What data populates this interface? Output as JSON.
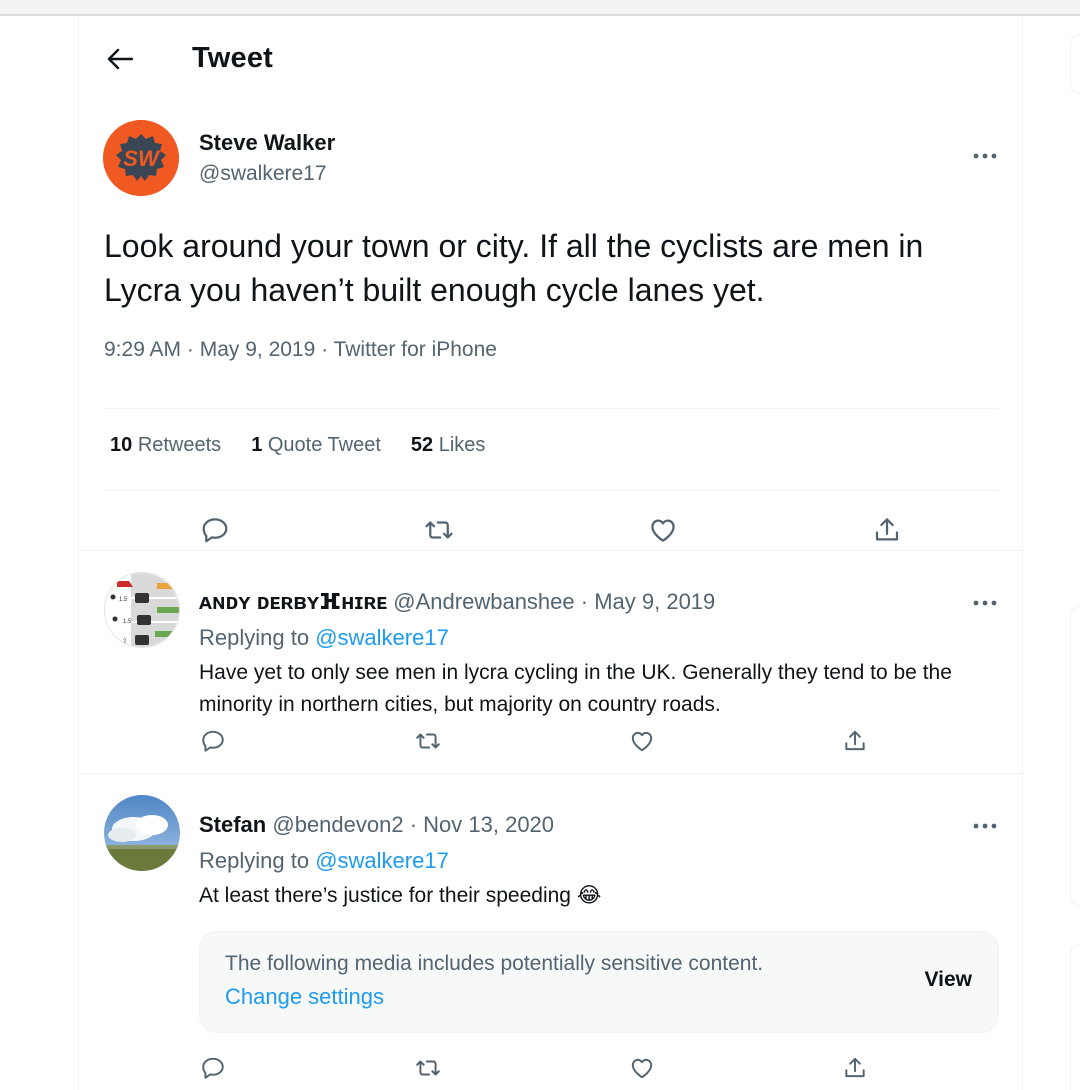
{
  "header": {
    "title": "Tweet"
  },
  "tweet": {
    "author_name": "Steve Walker",
    "author_handle": "@swalkere17",
    "avatar_text": "SW",
    "text": "Look around your town or city. If all the cyclists are men in Lycra you haven’t built enough cycle lanes yet.",
    "meta": "9:29 AM · May 9, 2019 · Twitter for iPhone",
    "stats": {
      "retweets_count": "10",
      "retweets_label": "Retweets",
      "quotes_count": "1",
      "quotes_label": "Quote Tweet",
      "likes_count": "52",
      "likes_label": "Likes"
    }
  },
  "replies": [
    {
      "name": "ᴀɴᴅʏ ᴅᴇʀʙʏⴼʜɪʀᴇ",
      "handle": "@Andrewbanshee",
      "date": "· May 9, 2019",
      "replying_prefix": "Replying to",
      "replying_to": "@swalkere17",
      "text": "Have yet to only see men in lycra cycling in the UK. Generally they tend to be the minority in northern cities, but majority on country roads."
    },
    {
      "name": "Stefan",
      "handle": "@bendevon2",
      "date": "· Nov 13, 2020",
      "replying_prefix": "Replying to",
      "replying_to": "@swalkere17",
      "text": "At least there’s justice for their speeding 😂",
      "sensitive": {
        "message": "The following media includes potentially sensitive content.",
        "link": "Change settings",
        "button": "View"
      }
    }
  ],
  "colors": {
    "accent": "#1d9bf0",
    "secondary_text": "#536471",
    "avatar_orange": "#f05a22"
  }
}
